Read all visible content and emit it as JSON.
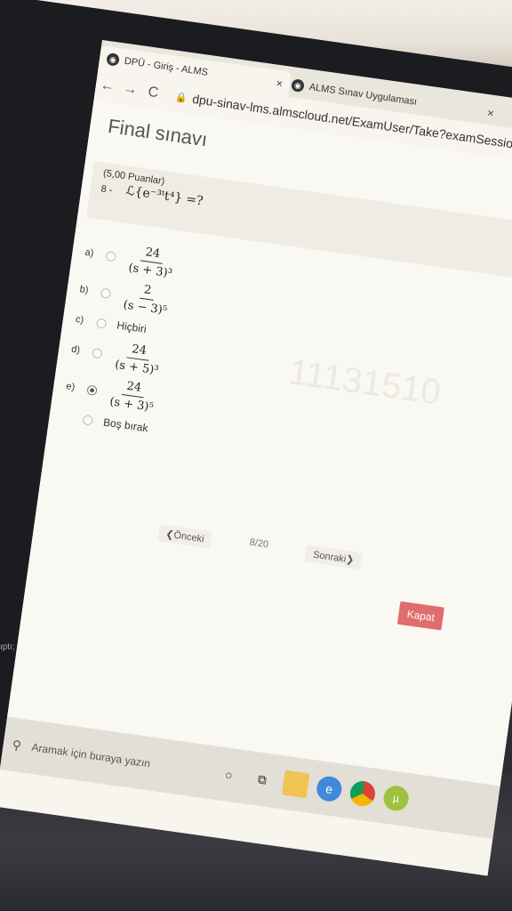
{
  "browser": {
    "tabs": [
      {
        "label": "DPÜ - Giriş - ALMS",
        "active": true
      },
      {
        "label": "ALMS Sınav Uygulaması",
        "active": false
      }
    ],
    "url": "dpu-sinav-lms.almscloud.net/ExamUser/Take?examSessionId",
    "nav": {
      "back": "←",
      "forward": "→",
      "reload": "C"
    }
  },
  "exam": {
    "title": "Final sınavı",
    "question": {
      "points": "(5,00 Puanlar)",
      "number": "8 -",
      "formula": "ℒ{e⁻³ᵗt⁴} =?"
    },
    "options": [
      {
        "letter": "a)",
        "numerator": "24",
        "denominator": "(s + 3)³",
        "selected": false
      },
      {
        "letter": "b)",
        "numerator": "2",
        "denominator": "(s − 3)⁵",
        "selected": false
      },
      {
        "letter": "c)",
        "text": "Hiçbiri",
        "selected": false
      },
      {
        "letter": "d)",
        "numerator": "24",
        "denominator": "(s + 5)³",
        "selected": false
      },
      {
        "letter": "e)",
        "numerator": "24",
        "denominator": "(s + 3)⁵",
        "selected": true
      }
    ],
    "skip_label": "Boş bırak",
    "pager": {
      "prev": "❮Önceki",
      "count": "8/20",
      "next": "Sonraki❯"
    },
    "close_label": "Kapat",
    "watermark": "11131510"
  },
  "taskbar": {
    "search_placeholder": "Aramak için buraya yazın",
    "sidebar_fragment": "ıptı;"
  }
}
